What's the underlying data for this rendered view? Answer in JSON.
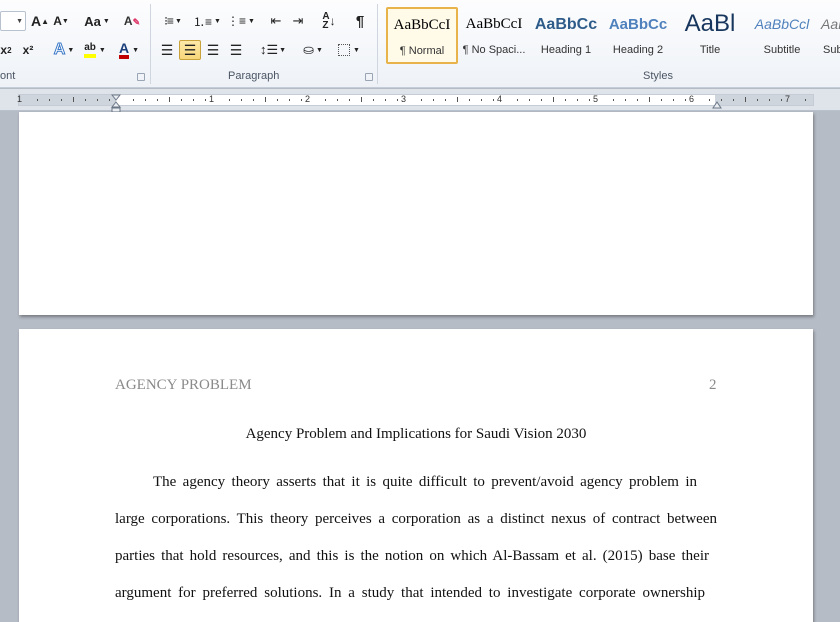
{
  "ribbon": {
    "font_group": {
      "label": "Font",
      "label_visible": "ont",
      "grow_font": "A",
      "shrink_font": "A",
      "change_case": "Aa",
      "subscript": "x",
      "superscript": "x²",
      "text_effects": "A",
      "highlight": "ab",
      "font_color": "A"
    },
    "paragraph_group": {
      "label": "Paragraph"
    },
    "styles_group": {
      "label": "Styles",
      "items": [
        {
          "sample": "AaBbCcI",
          "name": "¶ Normal"
        },
        {
          "sample": "AaBbCcI",
          "name": "¶ No Spaci..."
        },
        {
          "sample": "AaBbCc",
          "name": "Heading 1"
        },
        {
          "sample": "AaBbCc",
          "name": "Heading 2"
        },
        {
          "sample": "AaBl",
          "name": "Title"
        },
        {
          "sample": "AaBbCcl",
          "name": "Subtitle"
        },
        {
          "sample": "AaBbCcl",
          "name": "Sub"
        }
      ]
    }
  },
  "ruler": {
    "numbers": [
      "1",
      "1",
      "2",
      "3",
      "4",
      "5",
      "6",
      "7"
    ]
  },
  "document": {
    "header": "AGENCY PROBLEM",
    "page_number": "2",
    "title": "Agency Problem and Implications for Saudi Vision 2030",
    "lines": [
      "The agency theory asserts that it is quite difficult to prevent/avoid agency problem in",
      "large corporations. This theory perceives a corporation as a distinct nexus of contract between",
      "parties that hold resources, and this is the notion on which Al-Bassam et al. (2015) base their",
      "argument for preferred solutions. In a study that intended to investigate corporate ownership"
    ]
  },
  "colors": {
    "accent": "#2b579a",
    "selected_style_border": "#e8b34a",
    "highlight_yellow": "#ffff00",
    "font_red": "#c00000"
  }
}
